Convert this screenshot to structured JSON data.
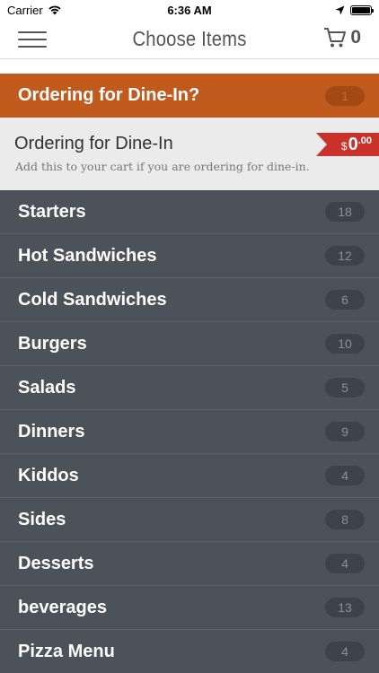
{
  "status_bar": {
    "carrier": "Carrier",
    "time": "6:36 AM"
  },
  "nav": {
    "title": "Choose Items",
    "cart_count": "0"
  },
  "dine_in_section": {
    "title": "Ordering for Dine-In?",
    "count": "1",
    "item": {
      "name": "Ordering for Dine-In",
      "description": "Add this to your cart if you are ordering for dine-in.",
      "price_currency": "$",
      "price_whole": "0",
      "price_cents": ".00"
    }
  },
  "categories": [
    {
      "label": "Starters",
      "count": "18"
    },
    {
      "label": "Hot Sandwiches",
      "count": "12"
    },
    {
      "label": "Cold Sandwiches",
      "count": "6"
    },
    {
      "label": "Burgers",
      "count": "10"
    },
    {
      "label": "Salads",
      "count": "5"
    },
    {
      "label": "Dinners",
      "count": "9"
    },
    {
      "label": "Kiddos",
      "count": "4"
    },
    {
      "label": "Sides",
      "count": "8"
    },
    {
      "label": "Desserts",
      "count": "4"
    },
    {
      "label": "beverages",
      "count": "13"
    },
    {
      "label": "Pizza Menu",
      "count": "4"
    }
  ],
  "colors": {
    "section_header": "#c05a1d",
    "price_tag": "#c9312b",
    "category_bg": "#4b525a"
  }
}
